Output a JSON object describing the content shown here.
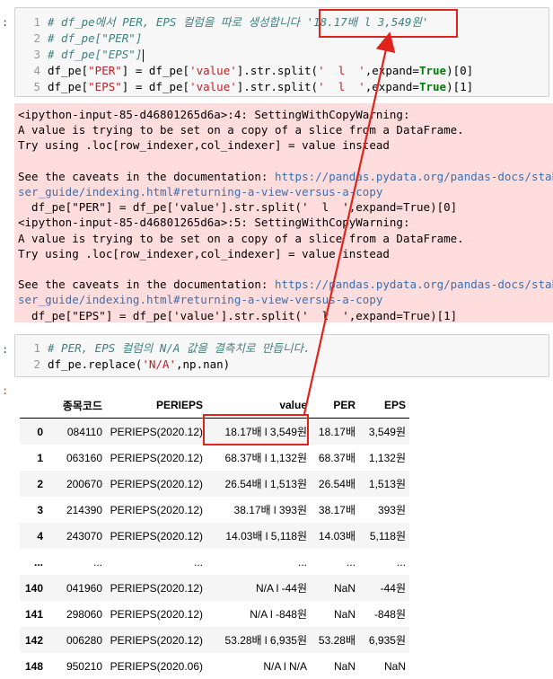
{
  "prompts": {
    "cell1": ":",
    "cell2": ":",
    "out2": ":"
  },
  "cell1": {
    "line_numbers": [
      "1",
      "2",
      "3",
      "4",
      "5"
    ],
    "comment1": "# df_pe에서 PER, EPS 컬럼을 따로 생성합니다 '18.17배 l 3,549원'",
    "comment2": "# df_pe[\"PER\"]",
    "comment3": "# df_pe[\"EPS\"]",
    "l4_a": "df_pe[",
    "l4_str1": "\"PER\"",
    "l4_b": "] = df_pe[",
    "l4_str2": "'value'",
    "l4_c": "].str.split(",
    "l4_str3": "'  l  '",
    "l4_d": ",expand=",
    "l4_kw": "True",
    "l4_e": ")[0]",
    "l5_a": "df_pe[",
    "l5_str1": "\"EPS\"",
    "l5_b": "] = df_pe[",
    "l5_str2": "'value'",
    "l5_c": "].str.split(",
    "l5_str3": "'  l  '",
    "l5_d": ",expand=",
    "l5_kw": "True",
    "l5_e": ")[1]"
  },
  "stderr": {
    "w1_head": "<ipython-input-85-d46801265d6a>:4: SettingWithCopyWarning:",
    "w1_l2": "A value is trying to be set on a copy of a slice from a DataFrame.",
    "w1_l3": "Try using .loc[row_indexer,col_indexer] = value instead",
    "w1_see": "See the caveats in the documentation: ",
    "w1_link1": "https://pandas.pydata.org/pandas-docs/stable/u",
    "w1_link2": "ser_guide/indexing.html#returning-a-view-versus-a-copy",
    "w1_code": "  df_pe[\"PER\"] = df_pe['value'].str.split('  l  ',expand=True)[0]",
    "w2_head": "<ipython-input-85-d46801265d6a>:5: SettingWithCopyWarning:",
    "w2_l2": "A value is trying to be set on a copy of a slice from a DataFrame.",
    "w2_l3": "Try using .loc[row_indexer,col_indexer] = value instead",
    "w2_see": "See the caveats in the documentation: ",
    "w2_link1": "https://pandas.pydata.org/pandas-docs/stable/u",
    "w2_link2": "ser_guide/indexing.html#returning-a-view-versus-a-copy",
    "w2_code": "  df_pe[\"EPS\"] = df_pe['value'].str.split('  l  ',expand=True)[1]"
  },
  "cell2": {
    "line_numbers": [
      "1",
      "2"
    ],
    "comment1": "# PER, EPS 컬럼의 N/A 값을 결측치로 만듭니다.",
    "l2_a": "df_pe.replace(",
    "l2_str": "'N/A'",
    "l2_b": ",np.nan)"
  },
  "table": {
    "columns": [
      "",
      "종목코드",
      "PERIEPS",
      "value",
      "PER",
      "EPS"
    ],
    "rows": [
      [
        "0",
        "084110",
        "PERIEPS(2020.12)",
        "18.17배 l 3,549원",
        "18.17배",
        "3,549원"
      ],
      [
        "1",
        "063160",
        "PERIEPS(2020.12)",
        "68.37배 l 1,132원",
        "68.37배",
        "1,132원"
      ],
      [
        "2",
        "200670",
        "PERIEPS(2020.12)",
        "26.54배 l 1,513원",
        "26.54배",
        "1,513원"
      ],
      [
        "3",
        "214390",
        "PERIEPS(2020.12)",
        "38.17배 l 393원",
        "38.17배",
        "393원"
      ],
      [
        "4",
        "243070",
        "PERIEPS(2020.12)",
        "14.03배 l 5,118원",
        "14.03배",
        "5,118원"
      ],
      [
        "...",
        "...",
        "...",
        "...",
        "...",
        "..."
      ],
      [
        "140",
        "041960",
        "PERIEPS(2020.12)",
        "N/A l -44원",
        "NaN",
        "-44원"
      ],
      [
        "141",
        "298060",
        "PERIEPS(2020.12)",
        "N/A l -848원",
        "NaN",
        "-848원"
      ],
      [
        "142",
        "006280",
        "PERIEPS(2020.12)",
        "53.28배 l 6,935원",
        "53.28배",
        "6,935원"
      ],
      [
        "148",
        "950210",
        "PERIEPS(2020.06)",
        "N/A l N/A",
        "NaN",
        "NaN"
      ]
    ]
  },
  "annotation_color": "#e0241c"
}
